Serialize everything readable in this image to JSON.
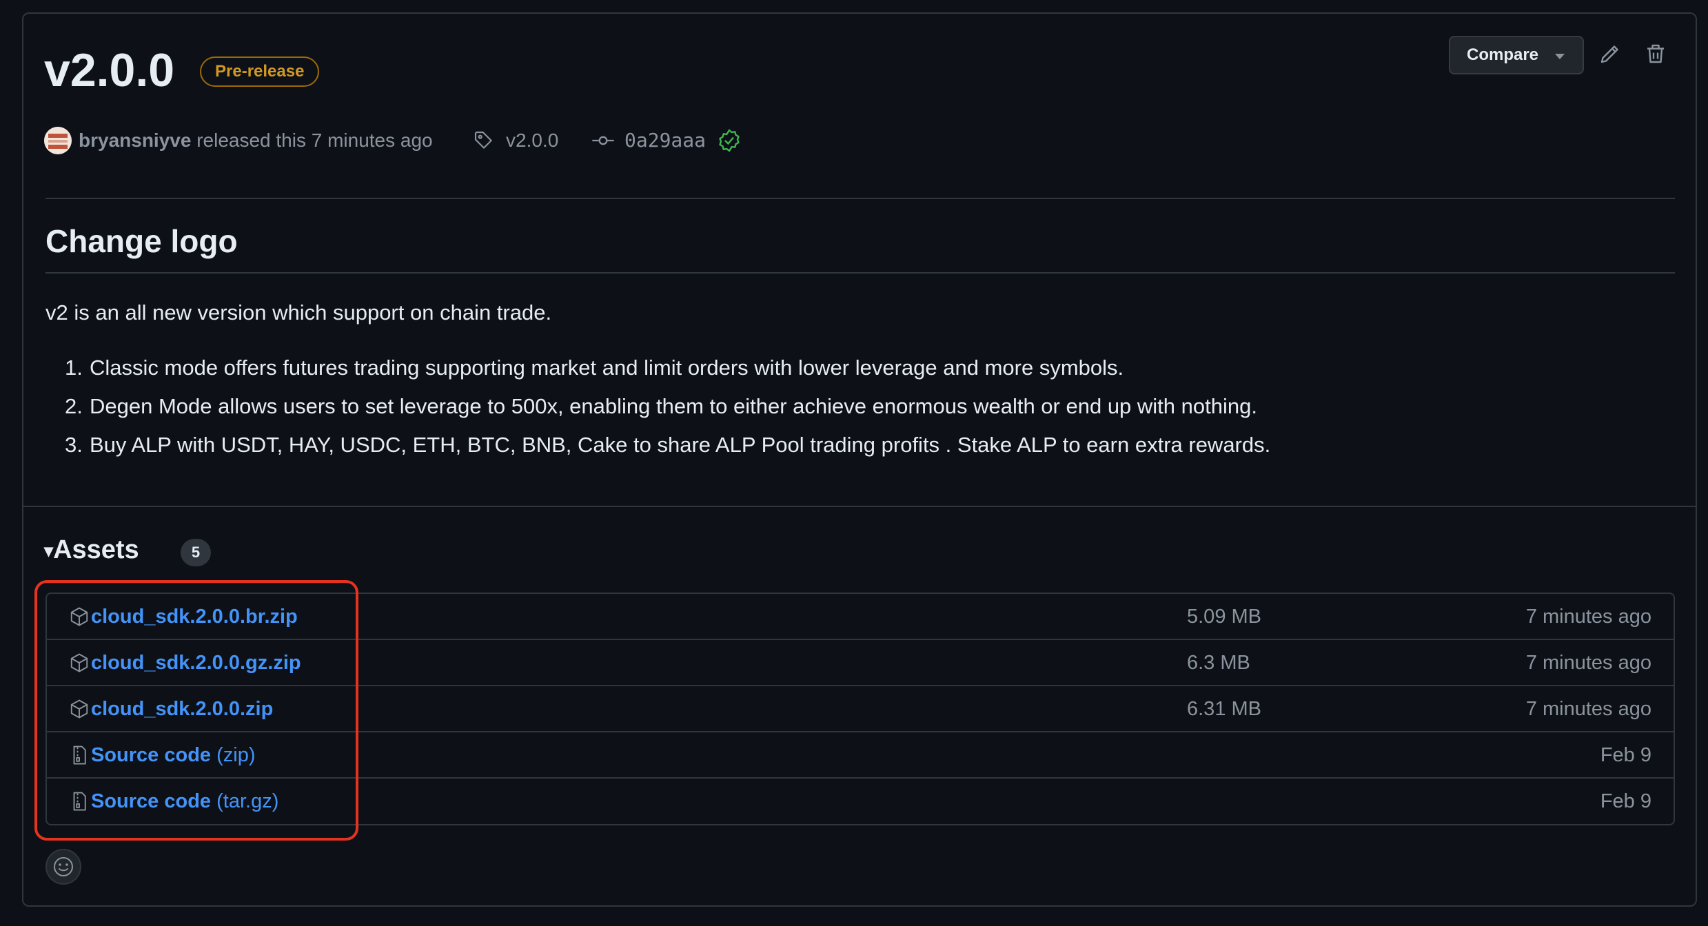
{
  "release": {
    "title": "v2.0.0",
    "badge": "Pre-release",
    "author": "bryansniyve",
    "released_text": "released this 7 minutes ago",
    "tag": "v2.0.0",
    "commit": "0a29aaa"
  },
  "toolbar": {
    "compare_label": "Compare"
  },
  "body": {
    "heading": "Change logo",
    "intro": "v2 is an all new version which support on chain trade.",
    "items": [
      {
        "num": "1.",
        "text": "Classic mode offers futures trading supporting market and limit orders with lower leverage and more symbols."
      },
      {
        "num": "2.",
        "text": "Degen Mode allows users to set leverage to 500x, enabling them to either achieve enormous wealth or end up with nothing."
      },
      {
        "num": "3.",
        "text": "Buy ALP with USDT, HAY, USDC, ETH, BTC, BNB, Cake to share ALP Pool trading profits . Stake ALP to earn extra rewards."
      }
    ]
  },
  "assets": {
    "heading": "Assets",
    "count": "5",
    "rows": [
      {
        "name": "cloud_sdk.2.0.0.br.zip",
        "sub": "",
        "size": "5.09 MB",
        "date": "7 minutes ago",
        "icon": "package-icon"
      },
      {
        "name": "cloud_sdk.2.0.0.gz.zip",
        "sub": "",
        "size": "6.3 MB",
        "date": "7 minutes ago",
        "icon": "package-icon"
      },
      {
        "name": "cloud_sdk.2.0.0.zip",
        "sub": "",
        "size": "6.31 MB",
        "date": "7 minutes ago",
        "icon": "package-icon"
      },
      {
        "name": "Source code",
        "sub": " (zip)",
        "size": "",
        "date": "Feb 9",
        "icon": "file-zip-icon"
      },
      {
        "name": "Source code",
        "sub": " (tar.gz)",
        "size": "",
        "date": "Feb 9",
        "icon": "file-zip-icon"
      }
    ]
  },
  "colors": {
    "link": "#4493f8",
    "badge": "#d29922",
    "verified": "#3fb950",
    "highlight": "#e5331f"
  }
}
